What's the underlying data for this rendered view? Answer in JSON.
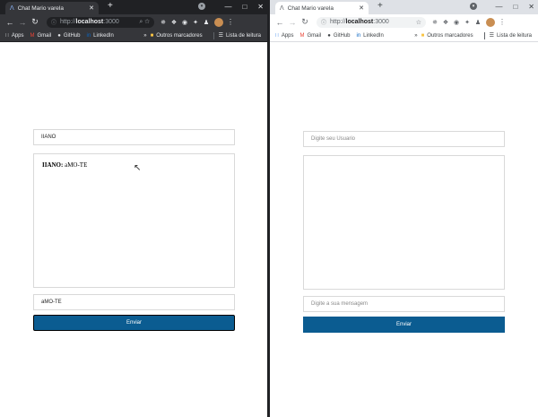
{
  "left_window": {
    "tab_title": "Chat Mario varela",
    "url_scheme": "http://",
    "url_host": "localhost",
    "url_port": ":3000",
    "profile_badge": "8",
    "bookmarks": [
      {
        "icon": "apps-grid-icon",
        "label": "Apps"
      },
      {
        "icon": "gmail-icon",
        "label": "Gmail"
      },
      {
        "icon": "github-icon",
        "label": "GitHub"
      },
      {
        "icon": "linkedin-icon",
        "label": "LinkedIn"
      }
    ],
    "other_bookmarks": "Outros marcadores",
    "reading_list": "Lista de leitura",
    "chat": {
      "username_value": "IIANO",
      "messages": [
        {
          "author": "IIANO:",
          "text": " aMO-TE"
        }
      ],
      "message_value": "aMO-TE",
      "send_label": "Enviar"
    }
  },
  "right_window": {
    "tab_title": "Chat Mario varela",
    "url_scheme": "http://",
    "url_host": "localhost",
    "url_port": ":3000",
    "bookmarks": [
      {
        "icon": "apps-grid-icon",
        "label": "Apps"
      },
      {
        "icon": "gmail-icon",
        "label": "Gmail"
      },
      {
        "icon": "github-icon",
        "label": "GitHub"
      },
      {
        "icon": "linkedin-icon",
        "label": "LinkedIn"
      }
    ],
    "other_bookmarks": "Outros marcadores",
    "reading_list": "Lista de leitura",
    "chat": {
      "username_placeholder": "Digite seu Usuario",
      "message_placeholder": "Digite a sua mensagem",
      "send_label": "Enviar"
    }
  },
  "colors": {
    "send_button": "#0b5c91",
    "dark_chrome": "#35363a",
    "light_chrome": "#dee1e6"
  }
}
